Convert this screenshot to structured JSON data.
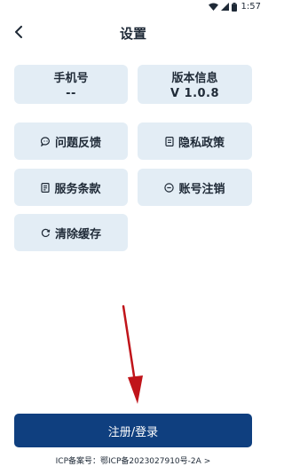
{
  "status_bar": {
    "time": "1:57",
    "icons": [
      "wifi-icon",
      "signal-icon",
      "battery-icon"
    ]
  },
  "header": {
    "title": "设置",
    "back_icon": "chevron-left-icon"
  },
  "info_cards": {
    "phone": {
      "label": "手机号",
      "value": "--"
    },
    "version": {
      "label": "版本信息",
      "value": "V 1.0.8"
    }
  },
  "menu": {
    "feedback": {
      "label": "问题反馈",
      "icon": "chat-bubble-icon"
    },
    "privacy": {
      "label": "隐私政策",
      "icon": "document-icon"
    },
    "terms": {
      "label": "服务条款",
      "icon": "clipboard-icon"
    },
    "cancel_account": {
      "label": "账号注销",
      "icon": "minus-circle-icon"
    },
    "clear_cache": {
      "label": "清除缓存",
      "icon": "refresh-icon"
    }
  },
  "login_button": {
    "label": "注册/登录"
  },
  "icp": {
    "text": "ICP备案号：鄂ICP备2023027910号-2A",
    "chevron": ">"
  },
  "colors": {
    "card_bg": "#e3edf5",
    "primary": "#0f3f7f",
    "arrow": "#c0141a"
  }
}
